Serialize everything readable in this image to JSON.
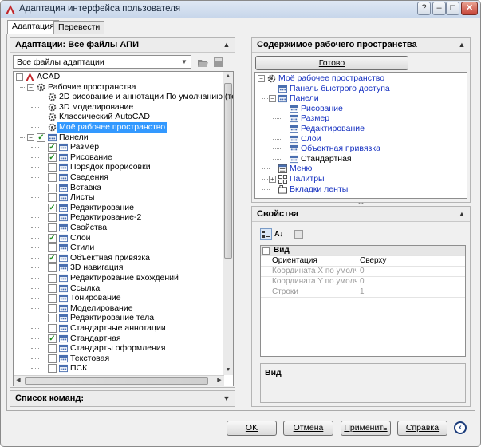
{
  "window": {
    "title": "Адаптация интерфейса пользователя",
    "controls": [
      "?",
      "–",
      "□",
      "✕"
    ]
  },
  "tabs": [
    {
      "label": "Адаптация",
      "active": true
    },
    {
      "label": "Перевести",
      "active": false
    }
  ],
  "left_panel": {
    "title": "Адаптации: Все файлы АПИ",
    "dropdown_value": "Все файлы адаптации",
    "tree": [
      {
        "label": "ACAD",
        "level": 0,
        "exp": "−",
        "icon": "acad-icon"
      },
      {
        "label": "Рабочие пространства",
        "level": 1,
        "exp": "−",
        "icon": "gear-icon"
      },
      {
        "label": "2D рисование и аннотации По умолчанию (текуща",
        "level": 2,
        "icon": "gear-icon"
      },
      {
        "label": "3D моделирование",
        "level": 2,
        "icon": "gear-icon"
      },
      {
        "label": "Классический AutoCAD",
        "level": 2,
        "icon": "gear-icon"
      },
      {
        "label": "Моё рабочее пространство",
        "level": 2,
        "icon": "gear-icon",
        "selected": true
      },
      {
        "label": "Панели",
        "level": 1,
        "exp": "−",
        "icon": "toolbar-icon",
        "check": "checked"
      },
      {
        "label": "Размер",
        "level": 2,
        "icon": "toolbar-icon",
        "check": "checked"
      },
      {
        "label": "Рисование",
        "level": 2,
        "icon": "toolbar-icon",
        "check": "checked"
      },
      {
        "label": "Порядок прорисовки",
        "level": 2,
        "icon": "toolbar-icon",
        "check": "empty"
      },
      {
        "label": "Сведения",
        "level": 2,
        "icon": "toolbar-icon",
        "check": "empty"
      },
      {
        "label": "Вставка",
        "level": 2,
        "icon": "toolbar-icon",
        "check": "empty"
      },
      {
        "label": "Листы",
        "level": 2,
        "icon": "toolbar-icon",
        "check": "empty"
      },
      {
        "label": "Редактирование",
        "level": 2,
        "icon": "toolbar-icon",
        "check": "checked"
      },
      {
        "label": "Редактирование-2",
        "level": 2,
        "icon": "toolbar-icon",
        "check": "empty"
      },
      {
        "label": "Свойства",
        "level": 2,
        "icon": "toolbar-icon",
        "check": "empty"
      },
      {
        "label": "Слои",
        "level": 2,
        "icon": "toolbar-icon",
        "check": "checked"
      },
      {
        "label": "Стили",
        "level": 2,
        "icon": "toolbar-icon",
        "check": "empty"
      },
      {
        "label": "Объектная привязка",
        "level": 2,
        "icon": "toolbar-icon",
        "check": "checked"
      },
      {
        "label": "3D навигация",
        "level": 2,
        "icon": "toolbar-icon",
        "check": "empty"
      },
      {
        "label": "Редактирование вхождений",
        "level": 2,
        "icon": "toolbar-icon",
        "check": "empty"
      },
      {
        "label": "Ссылка",
        "level": 2,
        "icon": "toolbar-icon",
        "check": "empty"
      },
      {
        "label": "Тонирование",
        "level": 2,
        "icon": "toolbar-icon",
        "check": "empty"
      },
      {
        "label": "Моделирование",
        "level": 2,
        "icon": "toolbar-icon",
        "check": "empty"
      },
      {
        "label": "Редактирование тела",
        "level": 2,
        "icon": "toolbar-icon",
        "check": "empty"
      },
      {
        "label": "Стандартные аннотации",
        "level": 2,
        "icon": "toolbar-icon",
        "check": "empty"
      },
      {
        "label": "Стандартная",
        "level": 2,
        "icon": "toolbar-icon",
        "check": "checked"
      },
      {
        "label": "Стандарты оформления",
        "level": 2,
        "icon": "toolbar-icon",
        "check": "empty"
      },
      {
        "label": "Текстовая",
        "level": 2,
        "icon": "toolbar-icon",
        "check": "empty"
      },
      {
        "label": "ПСК",
        "level": 2,
        "icon": "toolbar-icon",
        "check": "empty"
      }
    ]
  },
  "commands_panel": {
    "title": "Список команд:"
  },
  "workspace_panel": {
    "title": "Содержимое рабочего пространства",
    "done_button": "Готово",
    "tree": [
      {
        "label": "Моё рабочее пространство",
        "level": 0,
        "exp": "−",
        "icon": "gear-icon"
      },
      {
        "label": "Панель быстрого доступа",
        "level": 1,
        "icon": "toolbar-icon"
      },
      {
        "label": "Панели",
        "level": 1,
        "exp": "−",
        "icon": "toolbar-icon"
      },
      {
        "label": "Рисование",
        "level": 2,
        "icon": "toolbar-icon"
      },
      {
        "label": "Размер",
        "level": 2,
        "icon": "toolbar-icon"
      },
      {
        "label": "Редактирование",
        "level": 2,
        "icon": "toolbar-icon"
      },
      {
        "label": "Слои",
        "level": 2,
        "icon": "toolbar-icon"
      },
      {
        "label": "Объектная привязка",
        "level": 2,
        "icon": "toolbar-icon"
      },
      {
        "label": "Стандартная",
        "level": 2,
        "icon": "toolbar-icon",
        "plain": true
      },
      {
        "label": "Меню",
        "level": 1,
        "icon": "menu-icon"
      },
      {
        "label": "Палитры",
        "level": 1,
        "exp": "+",
        "icon": "palette-icon"
      },
      {
        "label": "Вкладки ленты",
        "level": 1,
        "icon": "ribbon-icon"
      }
    ]
  },
  "properties_panel": {
    "title": "Свойства",
    "category": "Вид",
    "rows": [
      {
        "key": "Ориентация",
        "value": "Сверху",
        "disabled": false
      },
      {
        "key": "Координата X по умолчан",
        "value": "0",
        "disabled": true
      },
      {
        "key": "Координата Y по умолчан",
        "value": "0",
        "disabled": true
      },
      {
        "key": "Строки",
        "value": "1",
        "disabled": true
      }
    ],
    "description_title": "Вид"
  },
  "footer": {
    "ok": "OK",
    "cancel": "Отмена",
    "apply": "Применить",
    "help": "Справка"
  },
  "colors": {
    "selection": "#3399ff",
    "link_text": "#1530c0",
    "check": "#1a8a1a"
  }
}
